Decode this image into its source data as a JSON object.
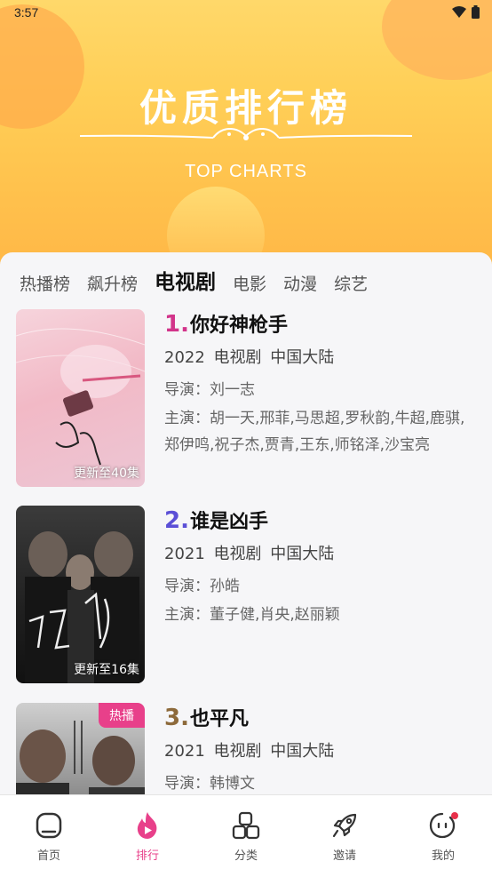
{
  "status": {
    "time": "3:57"
  },
  "hero": {
    "title": "优质排行榜",
    "subtitle": "TOP CHARTS"
  },
  "tabs": [
    {
      "label": "热播榜",
      "active": false
    },
    {
      "label": "飙升榜",
      "active": false
    },
    {
      "label": "电视剧",
      "active": true
    },
    {
      "label": "电影",
      "active": false
    },
    {
      "label": "动漫",
      "active": false
    },
    {
      "label": "综艺",
      "active": false
    }
  ],
  "items": [
    {
      "rank": "1.",
      "rank_color": "#d2348a",
      "title": "你好神枪手",
      "meta": "2022 电视剧 中国大陆",
      "director": "导演：刘一志",
      "cast": "主演：胡一天,邢菲,马思超,罗秋韵,牛超,鹿骐,郑伊鸣,祝子杰,贾青,王东,师铭泽,沙宝亮",
      "update": "更新至40集",
      "badge": ""
    },
    {
      "rank": "2.",
      "rank_color": "#5b4fd6",
      "title": "谁是凶手",
      "meta": "2021 电视剧 中国大陆",
      "director": "导演：孙皓",
      "cast": "主演：董子健,肖央,赵丽颖",
      "update": "更新至16集",
      "badge": ""
    },
    {
      "rank": "3.",
      "rank_color": "#8d6a3b",
      "title": "也平凡",
      "meta": "2021 电视剧 中国大陆",
      "director": "导演：韩博文",
      "cast": "",
      "update": "",
      "badge": "热播"
    }
  ],
  "nav": [
    {
      "label": "首页",
      "icon": "home-icon",
      "active": false
    },
    {
      "label": "排行",
      "icon": "flame-icon",
      "active": true
    },
    {
      "label": "分类",
      "icon": "category-icon",
      "active": false
    },
    {
      "label": "邀请",
      "icon": "rocket-icon",
      "active": false
    },
    {
      "label": "我的",
      "icon": "profile-icon",
      "active": false
    }
  ],
  "colors": {
    "accent": "#e8408a",
    "banner": "#ffc24d"
  }
}
